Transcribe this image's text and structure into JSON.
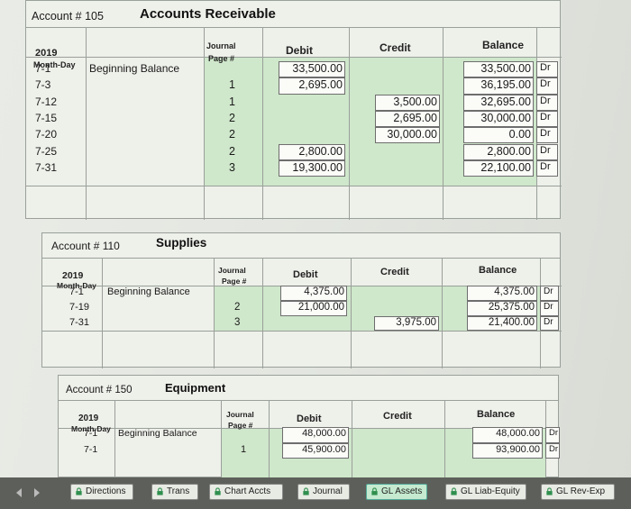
{
  "accounts": [
    {
      "number_label": "Account # 105",
      "title": "Accounts Receivable",
      "headers": {
        "year": "2019",
        "monthday": "Month-Day",
        "journal": "Journal",
        "page": "Page #",
        "debit": "Debit",
        "credit": "Credit",
        "balance": "Balance"
      },
      "rows": [
        {
          "date": "7-1",
          "desc": "Beginning Balance",
          "page": "",
          "debit": "33,500.00",
          "credit": "",
          "balance": "33,500.00",
          "dr": "Dr"
        },
        {
          "date": "7-3",
          "desc": "",
          "page": "1",
          "debit": "2,695.00",
          "credit": "",
          "balance": "36,195.00",
          "dr": "Dr"
        },
        {
          "date": "7-12",
          "desc": "",
          "page": "1",
          "debit": "",
          "credit": "3,500.00",
          "balance": "32,695.00",
          "dr": "Dr"
        },
        {
          "date": "7-15",
          "desc": "",
          "page": "2",
          "debit": "",
          "credit": "2,695.00",
          "balance": "30,000.00",
          "dr": "Dr"
        },
        {
          "date": "7-20",
          "desc": "",
          "page": "2",
          "debit": "",
          "credit": "30,000.00",
          "balance": "0.00",
          "dr": "Dr"
        },
        {
          "date": "7-25",
          "desc": "",
          "page": "2",
          "debit": "2,800.00",
          "credit": "",
          "balance": "2,800.00",
          "dr": "Dr"
        },
        {
          "date": "7-31",
          "desc": "",
          "page": "3",
          "debit": "19,300.00",
          "credit": "",
          "balance": "22,100.00",
          "dr": "Dr"
        }
      ]
    },
    {
      "number_label": "Account # 110",
      "title": "Supplies",
      "headers": {
        "year": "2019",
        "monthday": "Month-Day",
        "journal": "Journal",
        "page": "Page #",
        "debit": "Debit",
        "credit": "Credit",
        "balance": "Balance"
      },
      "rows": [
        {
          "date": "7-1",
          "desc": "Beginning Balance",
          "page": "",
          "debit": "4,375.00",
          "credit": "",
          "balance": "4,375.00",
          "dr": "Dr"
        },
        {
          "date": "7-19",
          "desc": "",
          "page": "2",
          "debit": "21,000.00",
          "credit": "",
          "balance": "25,375.00",
          "dr": "Dr"
        },
        {
          "date": "7-31",
          "desc": "",
          "page": "3",
          "debit": "",
          "credit": "3,975.00",
          "balance": "21,400.00",
          "dr": "Dr"
        }
      ]
    },
    {
      "number_label": "Account # 150",
      "title": "Equipment",
      "headers": {
        "year": "2019",
        "monthday": "Month-Day",
        "journal": "Journal",
        "page": "Page #",
        "debit": "Debit",
        "credit": "Credit",
        "balance": "Balance"
      },
      "rows": [
        {
          "date": "7-1",
          "desc": "Beginning Balance",
          "page": "",
          "debit": "48,000.00",
          "credit": "",
          "balance": "48,000.00",
          "dr": "Dr"
        },
        {
          "date": "7-1",
          "desc": "",
          "page": "1",
          "debit": "45,900.00",
          "credit": "",
          "balance": "93,900.00",
          "dr": "Dr"
        }
      ]
    }
  ],
  "tabs": [
    {
      "label": "Directions",
      "active": false
    },
    {
      "label": "Trans",
      "active": false
    },
    {
      "label": "Chart Accts",
      "active": false
    },
    {
      "label": "Journal",
      "active": false
    },
    {
      "label": "GL Assets",
      "active": true
    },
    {
      "label": "GL Liab-Equity",
      "active": false
    },
    {
      "label": "GL Rev-Exp",
      "active": false
    }
  ],
  "colors": {
    "green": "#cfe7cb",
    "tabbar": "#5d605a",
    "active_tab": "#c5ead0"
  }
}
